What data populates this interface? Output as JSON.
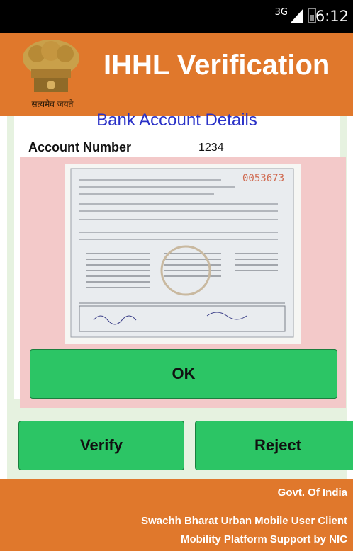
{
  "status_bar": {
    "network_type": "3G",
    "time": "6:12",
    "icons": [
      "signal-icon",
      "battery-icon"
    ]
  },
  "header": {
    "title": "IHHL Verification",
    "emblem_caption": "सत्यमेव जयते",
    "emblem_icon": "national-emblem-icon"
  },
  "content": {
    "section_heading": "Bank Account Details",
    "account_number_label": "Account Number",
    "account_number_value": "1234"
  },
  "document": {
    "image_icon": "scanned-marksheet-image",
    "serial_number": "0053673"
  },
  "dialog": {
    "ok_label": "OK"
  },
  "actions": {
    "verify_label": "Verify",
    "reject_label": "Reject"
  },
  "footer": {
    "line1": "Govt. Of India",
    "line2": "Swachh Bharat Urban Mobile User Client",
    "line3": "Mobility Platform Support by NIC"
  },
  "colors": {
    "header_bg": "#e0782c",
    "button_green": "#2cc565",
    "overlay_pink": "#f3c9c9",
    "heading_blue": "#2b32c7",
    "content_bg": "#e6f2e0"
  }
}
